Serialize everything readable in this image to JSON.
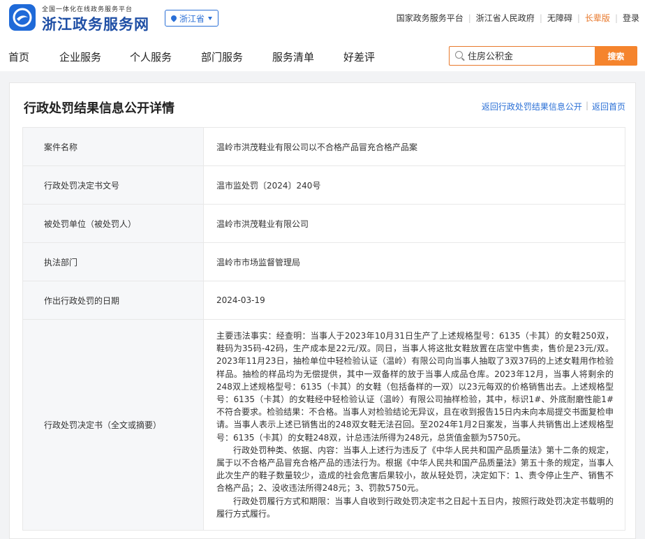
{
  "header": {
    "logo_sub": "全国一体化在线政务服务平台",
    "logo_main": "浙江政务服务网",
    "region": "浙江省",
    "top_links": [
      "国家政务服务平台",
      "浙江省人民政府",
      "无障碍",
      "长辈版",
      "登录"
    ],
    "accent_color": "#e8792c",
    "brand_color": "#1f6ad8"
  },
  "nav": {
    "items": [
      "首页",
      "企业服务",
      "个人服务",
      "部门服务",
      "服务清单",
      "好差评"
    ]
  },
  "search": {
    "placeholder": "住房公积金",
    "button": "搜索"
  },
  "page": {
    "title": "行政处罚结果信息公开详情",
    "link_back_list": "返回行政处罚结果信息公开",
    "link_home": "返回首页"
  },
  "rows": [
    {
      "label": "案件名称",
      "value": "温岭市洪茂鞋业有限公司以不合格产品冒充合格产品案"
    },
    {
      "label": "行政处罚决定书文号",
      "value": "温市监处罚〔2024〕240号"
    },
    {
      "label": "被处罚单位（被处罚人）",
      "value": "温岭市洪茂鞋业有限公司"
    },
    {
      "label": "执法部门",
      "value": "温岭市市场监督管理局"
    },
    {
      "label": "作出行政处罚的日期",
      "value": "2024-03-19"
    }
  ],
  "decision": {
    "label": "行政处罚决定书（全文或摘要）",
    "para1": "主要违法事实：经查明：当事人于2023年10月31日生产了上述规格型号：6135（卡其）的女鞋250双，鞋码为35码-42码，生产成本是22元/双。同日，当事人将这批女鞋放置在店堂中售卖，售价是23元/双。2023年11月23日，抽检单位中轻检验认证（温岭）有限公司向当事人抽取了3双37码的上述女鞋用作检验样品。抽检的样品均为无偿提供，其中一双备样的放于当事人成品仓库。2023年12月，当事人将剩余的248双上述规格型号：6135（卡其）的女鞋（包括备样的一双）以23元每双的价格销售出去。上述规格型号：6135（卡其）的女鞋经中轻检验认证（温岭）有限公司抽样检验，其中，标识1#、外底耐磨性能1#不符合要求。检验结果：不合格。当事人对检验结论无异议，且在收到报告15日内未向本局提交书面复检申请。当事人表示上述已销售出的248双女鞋无法召回。至2024年1月2日案发，当事人共销售出上述规格型号：6135（卡其）的女鞋248双，计总违法所得为248元，总货值金额为5750元。",
    "para2": "行政处罚种类、依据、内容：当事人上述行为违反了《中华人民共和国产品质量法》第十二条的规定，属于以不合格产品冒充合格产品的违法行为。根据《中华人民共和国产品质量法》第五十条的规定，当事人此次生产的鞋子数量较少，造成的社会危害后果较小，故从轻处罚，决定如下：1、责令停止生产、销售不合格产品；2、没收违法所得248元；3、罚款5750元。",
    "para3": "行政处罚履行方式和期限：当事人自收到行政处罚决定书之日起十五日内，按照行政处罚决定书载明的履行方式履行。"
  }
}
